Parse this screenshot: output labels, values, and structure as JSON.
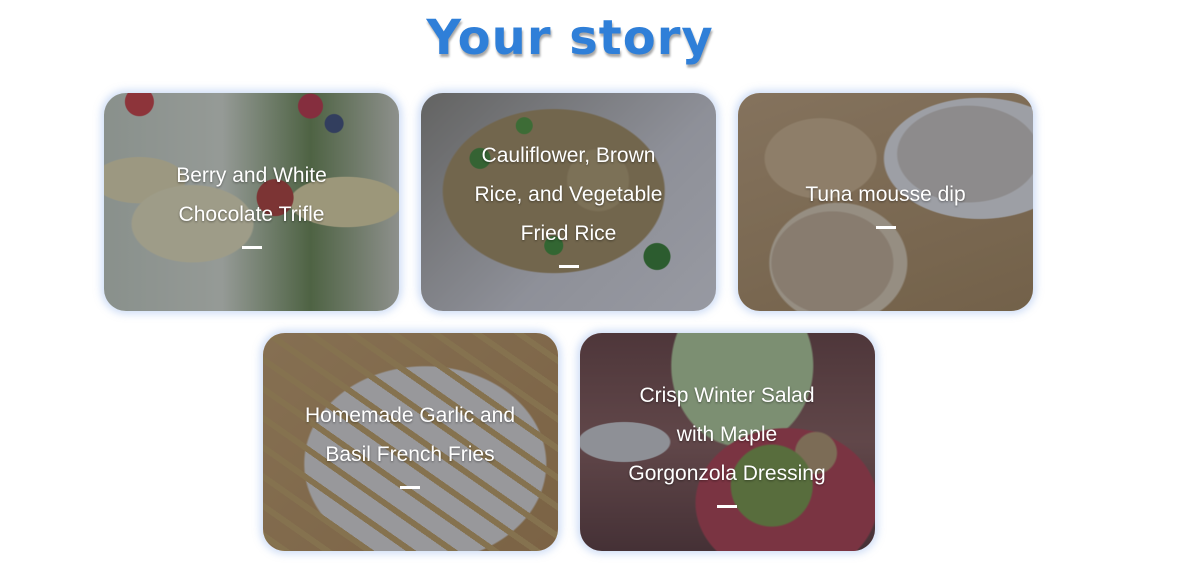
{
  "page": {
    "title": "Your story"
  },
  "recipes": [
    {
      "title": "Berry and White Chocolate Trifle"
    },
    {
      "title": "Cauliflower, Brown Rice, and Vegetable Fried Rice"
    },
    {
      "title": "Tuna mousse dip"
    },
    {
      "title": "Homemade Garlic and Basil French Fries"
    },
    {
      "title": "Crisp Winter Salad with Maple Gorgonzola Dressing"
    }
  ],
  "colors": {
    "title": "#2f7fd8",
    "card_text": "#ffffff",
    "card_glow": "#78a0e6"
  }
}
